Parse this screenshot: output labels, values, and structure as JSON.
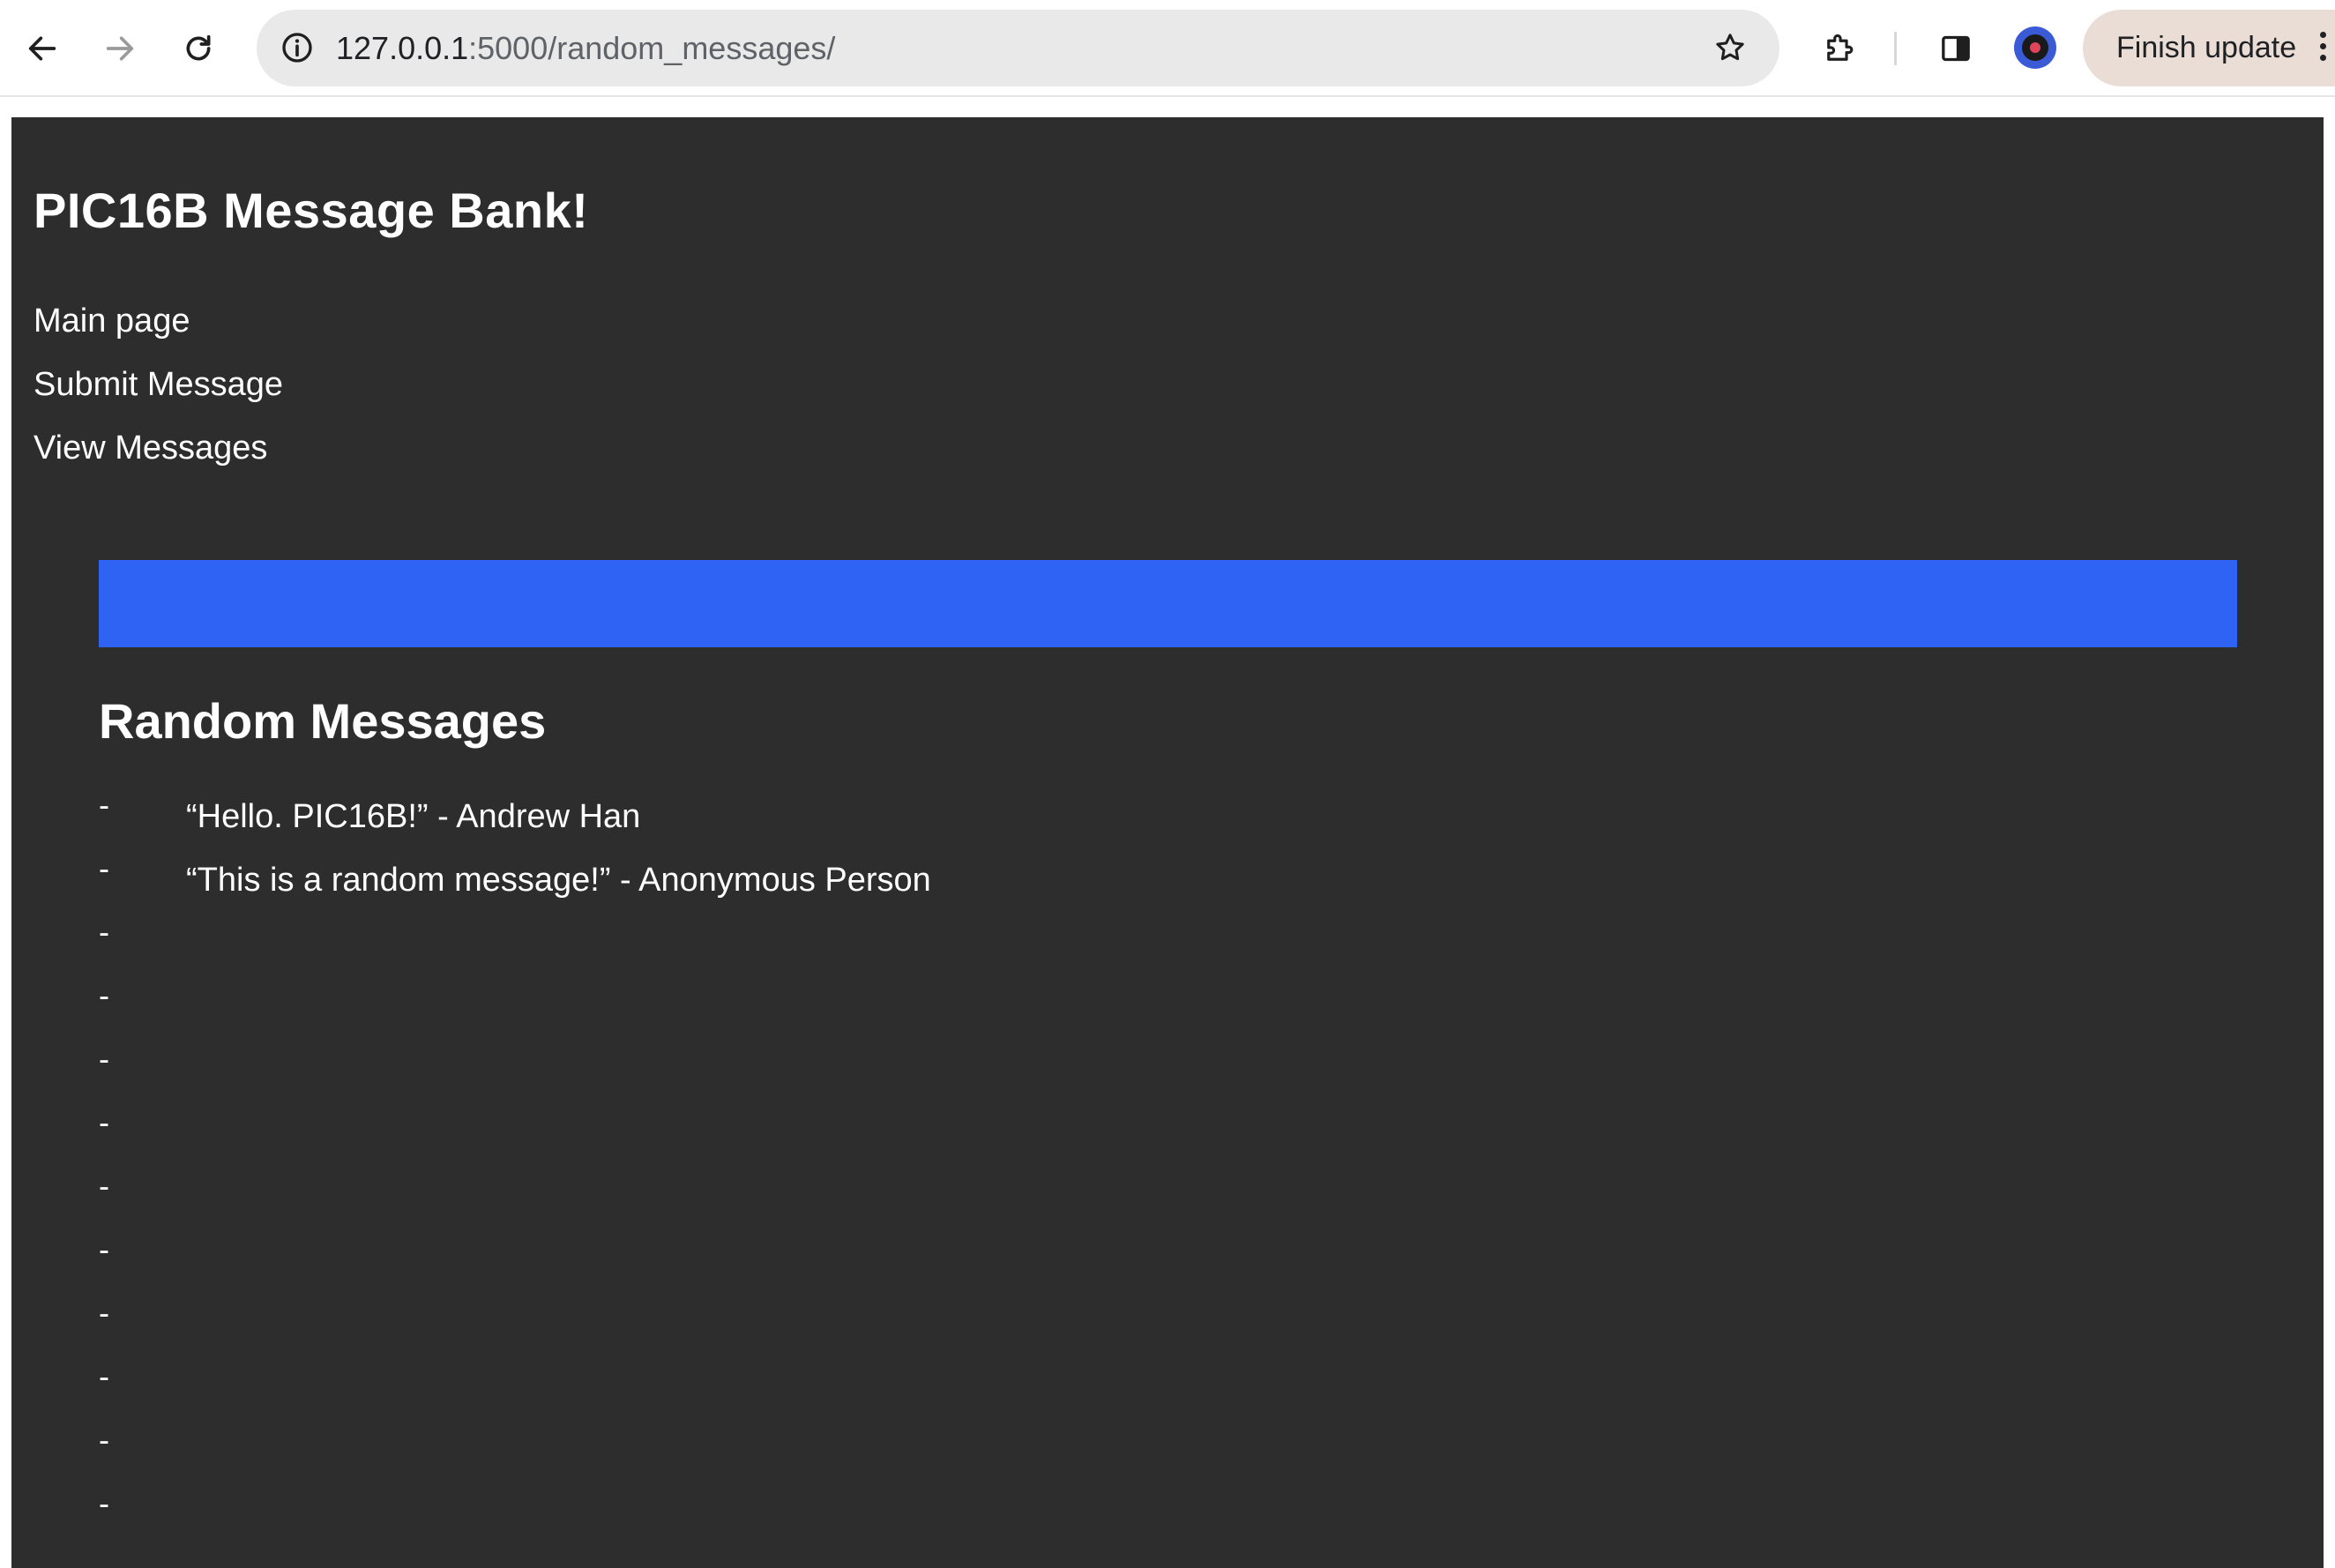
{
  "browser": {
    "url_host": "127.0.0.1",
    "url_rest": ":5000/random_messages/",
    "update_button_label": "Finish update",
    "icons": {
      "back": "back-arrow-icon",
      "forward": "forward-arrow-icon",
      "reload": "reload-icon",
      "site_info": "info-icon",
      "bookmark": "star-icon",
      "extensions": "puzzle-icon",
      "side_panel": "side-panel-icon",
      "profile": "profile-avatar",
      "menu": "kebab-menu-icon"
    }
  },
  "page": {
    "title": "PIC16B Message Bank!",
    "nav": [
      {
        "label": "Main page"
      },
      {
        "label": "Submit Message"
      },
      {
        "label": "View Messages"
      }
    ],
    "banner_color": "#2f63f3",
    "section_title": "Random Messages",
    "messages": [
      {
        "dash": "-",
        "text": "“Hello. PIC16B!” - Andrew Han"
      },
      {
        "dash": "-",
        "text": "“This is a random message!” - Anonymous Person"
      },
      {
        "dash": "-",
        "text": ""
      },
      {
        "dash": "-",
        "text": ""
      },
      {
        "dash": "-",
        "text": ""
      },
      {
        "dash": "-",
        "text": ""
      },
      {
        "dash": "-",
        "text": ""
      },
      {
        "dash": "-",
        "text": ""
      },
      {
        "dash": "-",
        "text": ""
      },
      {
        "dash": "-",
        "text": ""
      },
      {
        "dash": "-",
        "text": ""
      },
      {
        "dash": "-",
        "text": ""
      }
    ]
  }
}
